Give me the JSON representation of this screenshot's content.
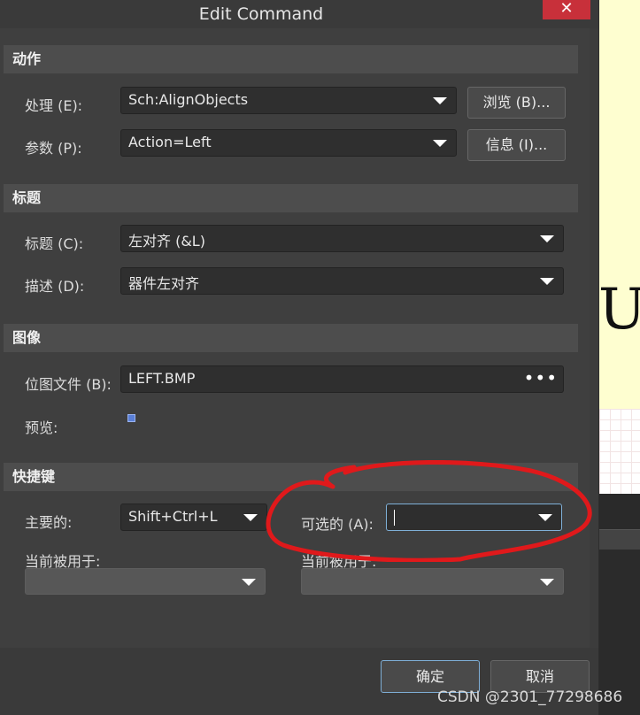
{
  "window": {
    "title": "Edit Command",
    "close_glyph": "✕"
  },
  "sections": {
    "action": {
      "header": "动作",
      "process_label": "处理 (E):",
      "process_value": "Sch:AlignObjects",
      "browse_button": "浏览 (B)...",
      "params_label": "参数 (P):",
      "params_value": "Action=Left",
      "info_button": "信息 (I)..."
    },
    "caption": {
      "header": "标题",
      "caption_label": "标题 (C):",
      "caption_value": "左对齐 (&L)",
      "desc_label": "描述 (D):",
      "desc_value": "器件左对齐"
    },
    "image": {
      "header": "图像",
      "bitmap_label": "位图文件 (B):",
      "bitmap_value": "LEFT.BMP",
      "ellipsis": "•••",
      "preview_label": "预览:"
    },
    "shortcut": {
      "header": "快捷键",
      "primary_label": "主要的:",
      "primary_value": "Shift+Ctrl+L",
      "alternate_label": "可选的 (A):",
      "alternate_value": "",
      "current_used_label_1": "当前被用于:",
      "current_used_label_2": "当前被用于:"
    }
  },
  "footer": {
    "ok_button": "确定",
    "cancel_button": "取消"
  },
  "background_letter": "U",
  "watermark": "CSDN @2301_77298686",
  "colors": {
    "annotation": "#e0191b",
    "focus": "#7fb0d8",
    "close": "#c8303a"
  }
}
